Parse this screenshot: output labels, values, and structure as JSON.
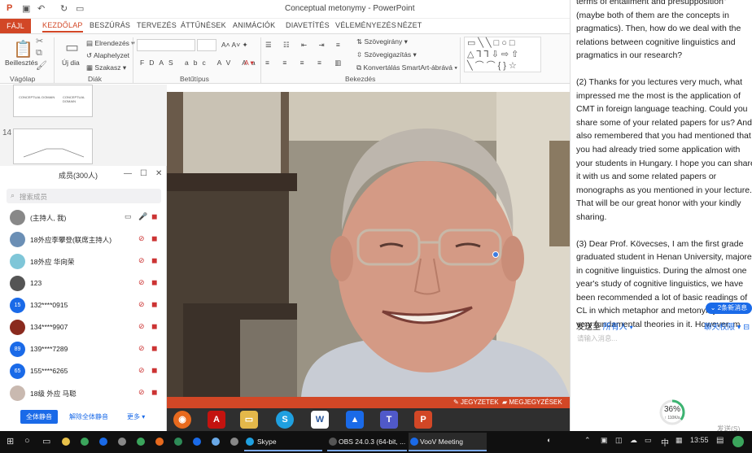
{
  "ppt": {
    "title": "Conceptual metonymy - PowerPoint",
    "tabs": [
      "FÁJL",
      "KEZDŐLAP",
      "BESZÚRÁS",
      "TERVEZÉS",
      "ÁTTŰNÉSEK",
      "ANIMÁCIÓK",
      "DIAVETÍTÉS",
      "VÉLEMÉNYEZÉS",
      "NÉZET"
    ],
    "ribbon": {
      "paste": "Beillesztés",
      "new_slide": "Új dia",
      "layout": "Elrendezés",
      "reset": "Alaphelyzet",
      "section": "Szakasz",
      "text_direction": "Szövegirány",
      "align_text": "Szövegigazítás",
      "convert_smartart": "Konvertálás SmartArt-ábrává",
      "groups": {
        "clipboard": "Vágólap",
        "slides": "Diák",
        "font": "Betűtípus",
        "paragraph": "Bekezdés"
      }
    },
    "thumbs": {
      "slide_number": "14",
      "mini_text_a": "CONCEPTUAL DOMAIN",
      "mini_text_b": "CONCEPTUAL DOMAIN"
    },
    "status": {
      "notes": "JEGYZETEK",
      "comments": "MEGJEGYZÉSEK"
    }
  },
  "members": {
    "title": "成员(300人)",
    "search_placeholder": "搜索成员",
    "list": [
      {
        "name": "(主持人, 我)",
        "avatar": "",
        "color": "#888888"
      },
      {
        "name": "18外应李攀登(联席主持人)",
        "avatar": "",
        "color": "#6b8fb5"
      },
      {
        "name": "18外应 华向荣",
        "avatar": "",
        "color": "#7fc6d8"
      },
      {
        "name": "123",
        "avatar": "",
        "color": "#555555"
      },
      {
        "name": "132****0915",
        "avatar": "15",
        "color": "#1a6ae8"
      },
      {
        "name": "134****9907",
        "avatar": "",
        "color": "#8a2a1e"
      },
      {
        "name": "139****7289",
        "avatar": "89",
        "color": "#1a6ae8"
      },
      {
        "name": "155****6265",
        "avatar": "65",
        "color": "#1a6ae8"
      },
      {
        "name": "18级 外应 马聪",
        "avatar": "",
        "color": "#c9b9b0"
      }
    ],
    "footer": {
      "mute_all": "全体静音",
      "unmute_all": "解除全体静音",
      "more": "更多"
    }
  },
  "chat": {
    "paragraphs": [
      "terms of entailment and presupposition\" (maybe both of them are the concepts in pragmatics). Then, how do we deal with the relations between cognitive linguistics and pragmatics in our research?",
      "(2) Thanks for you lectures very much, what impressed me the most is the application of CMT in foreign language teaching. Could you share some of your related papers for us? And I also remembered that you had mentioned that you had already tried some application with your students in Hungary. I hope you can share it with us and some related papers or monographs as you mentioned in your lecture. That will be our great honor with your kindly sharing.",
      "(3) Dear Prof. Kövecses, I am the first grade graduated student in Henan University, majored in cognitive linguistics. During the almost one year's study of cognitive linguistics, we have been recommended a lot of basic readings of CL in which metaphor and metonymy are the very fundamental theories in it. However, m"
    ],
    "new_messages": "2条新消息",
    "send_to_label": "发送至",
    "send_to_target": "所有人",
    "permissions": "聊天权限",
    "input_placeholder": "请输入消息...",
    "progress": {
      "value": "36%",
      "fraction": 0.36,
      "speed": "↑ 110K/s"
    },
    "send": "发送(S)"
  },
  "taskbar": {
    "skype": "Skype",
    "obs": "OBS 24.0.3 (64-bit, ...",
    "voov": "VooV Meeting",
    "lang": "中",
    "time": "13:55"
  },
  "colors": {
    "ppt_accent": "#d24726",
    "voov_blue": "#1a6ae8",
    "taskbar": "#101010"
  }
}
